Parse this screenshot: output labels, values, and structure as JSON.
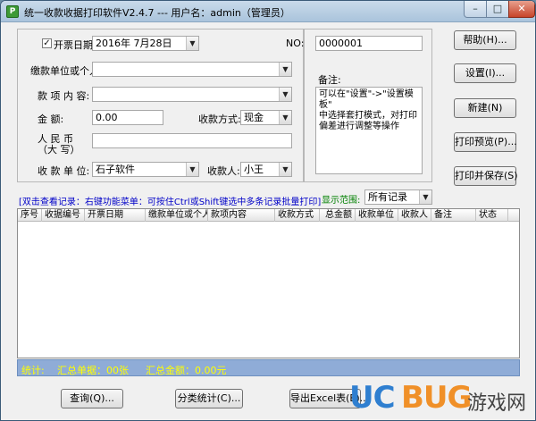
{
  "window": {
    "title": "统一收款收据打印软件V2.4.7 --- 用户名：admin（管理员）",
    "icon_text": "P"
  },
  "form": {
    "date_label": "开票日期:",
    "date_checked": true,
    "date_value": "2016年  7月28日",
    "no_label": "NO:",
    "no_value": "0000001",
    "payer_label": "缴款单位或个人:",
    "payer_value": "",
    "item_label": "款  项  内  容:",
    "item_value": "",
    "amount_label": "金        额:",
    "amount_value": "0.00",
    "method_label": "收款方式:",
    "method_value": "现金",
    "rmb_label_1": "人    民    币",
    "rmb_label_2": "（大   写）",
    "rmb_value": "",
    "unit_label": "收  款  单  位:",
    "unit_value": "石子软件",
    "receiver_label": "收款人:",
    "receiver_value": "小王",
    "remark_label": "备注:",
    "remark_text": "可以在\"设置\"->\"设置模板\"\n中选择套打模式，对打印\n偏差进行调整等操作"
  },
  "buttons": {
    "help": "帮助(H)...",
    "settings": "设置(I)...",
    "new": "新建(N)",
    "preview": "打印预览(P)...",
    "print_save": "打印并保存(S)",
    "query": "查询(Q)...",
    "category": "分类统计(C)...",
    "export": "导出Excel表(E)..."
  },
  "list": {
    "hint": "[双击查看记录：右键功能菜单：可按住Ctrl或Shift键选中多条记录批量打印]",
    "range_label": "显示范围:",
    "range_value": "所有记录",
    "columns": [
      "序号",
      "收据编号",
      "开票日期",
      "缴款单位或个人",
      "款项内容",
      "收款方式",
      "总金额",
      "收款单位",
      "收款人",
      "备注",
      "状态"
    ]
  },
  "status": {
    "stat_label": "统计:",
    "total_count": "汇总单据：00张",
    "total_amount": "汇总金额：0.00元"
  },
  "watermark": {
    "uc": "UC",
    "bug": "BUG",
    "cn": "游戏网"
  }
}
